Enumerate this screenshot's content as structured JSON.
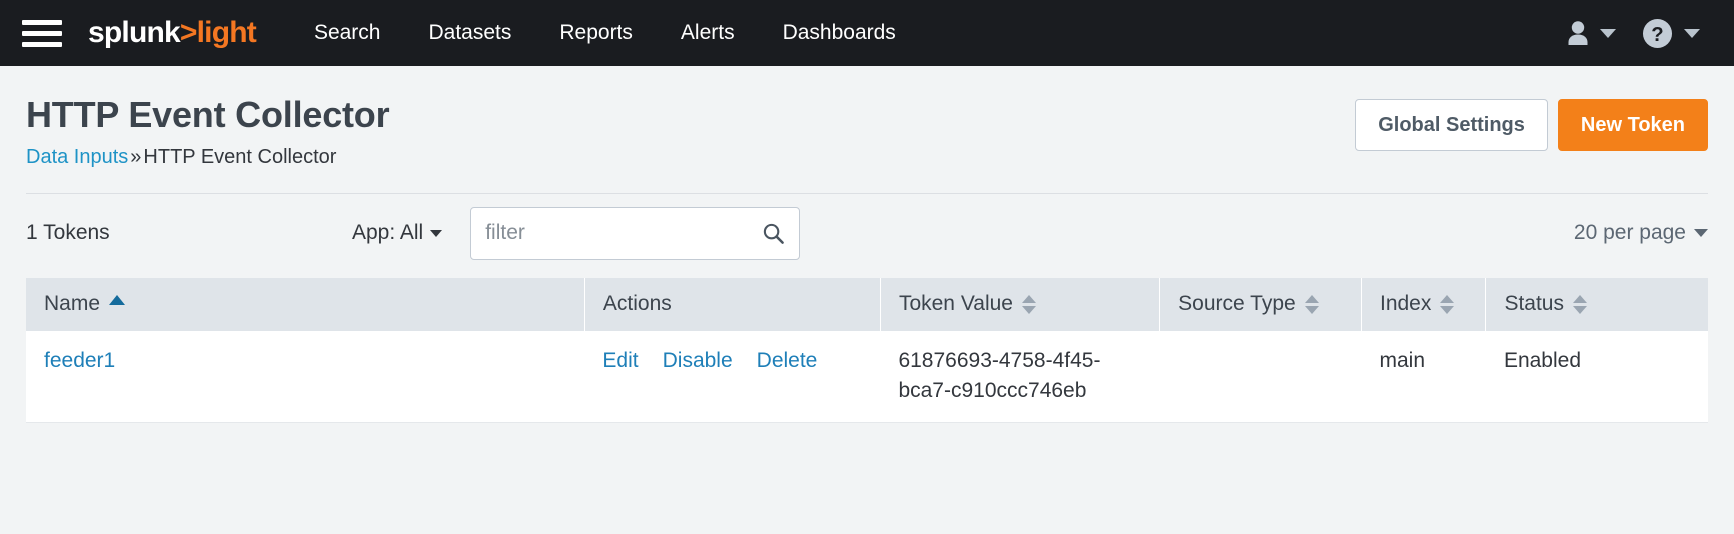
{
  "navbar": {
    "menu_icon": "hamburger-icon",
    "logo": {
      "part1": "splunk",
      "part2": ">",
      "part3": "light"
    },
    "links": [
      {
        "label": "Search"
      },
      {
        "label": "Datasets"
      },
      {
        "label": "Reports"
      },
      {
        "label": "Alerts"
      },
      {
        "label": "Dashboards"
      }
    ],
    "user_icon": "person-icon",
    "help_icon": "help-circle-icon"
  },
  "header": {
    "title": "HTTP Event Collector",
    "breadcrumb": {
      "link": "Data Inputs",
      "separator": "»",
      "current": "HTTP Event Collector"
    },
    "global_settings_label": "Global Settings",
    "new_token_label": "New Token"
  },
  "controls": {
    "token_count": "1 Tokens",
    "app_filter_label": "App: All",
    "filter_placeholder": "filter",
    "filter_value": "",
    "per_page_label": "20 per page"
  },
  "table": {
    "columns": [
      {
        "label": "Name",
        "sort": "asc"
      },
      {
        "label": "Actions",
        "sort": "none"
      },
      {
        "label": "Token Value",
        "sort": "both"
      },
      {
        "label": "Source Type",
        "sort": "both"
      },
      {
        "label": "Index",
        "sort": "both"
      },
      {
        "label": "Status",
        "sort": "both"
      }
    ],
    "rows": [
      {
        "name": "feeder1",
        "actions": [
          "Edit",
          "Disable",
          "Delete"
        ],
        "token_value_line1": "61876693-4758-4f45-",
        "token_value_line2": "bca7-c910ccc746eb",
        "source_type": "",
        "index": "main",
        "status": "Enabled"
      }
    ]
  },
  "colors": {
    "navbar_bg": "#1a1c20",
    "brand_orange": "#f38019",
    "link_blue": "#1e7fb8",
    "page_bg": "#f2f4f5",
    "table_header_bg": "#dfe4e9",
    "sort_active": "#156b9c"
  }
}
